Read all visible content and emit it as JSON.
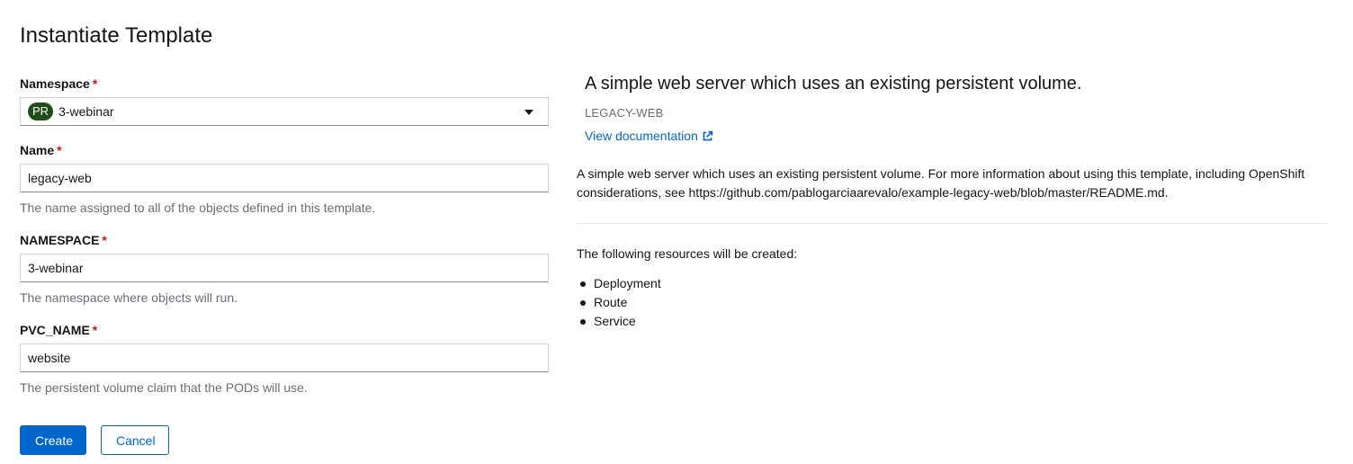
{
  "page": {
    "title": "Instantiate Template"
  },
  "form": {
    "namespace": {
      "label": "Namespace",
      "required_mark": "*",
      "badge": "PR",
      "value": "3-webinar"
    },
    "name": {
      "label": "Name",
      "required_mark": "*",
      "value": "legacy-web",
      "helper": "The name assigned to all of the objects defined in this template."
    },
    "namespace_param": {
      "label": "NAMESPACE",
      "required_mark": "*",
      "value": "3-webinar",
      "helper": "The namespace where objects will run."
    },
    "pvc_name": {
      "label": "PVC_NAME",
      "required_mark": "*",
      "value": "website",
      "helper": "The persistent volume claim that the PODs will use."
    }
  },
  "actions": {
    "create_label": "Create",
    "cancel_label": "Cancel"
  },
  "template_info": {
    "title": "A simple web server which uses an existing persistent volume.",
    "subtitle": "LEGACY-WEB",
    "doc_link_label": "View documentation",
    "description": "A simple web server which uses an existing persistent volume. For more information about using this template, including OpenShift considerations, see https://github.com/pablogarciaarevalo/example-legacy-web/blob/master/README.md.",
    "resources_heading": "The following resources will be created:",
    "resources": [
      "Deployment",
      "Route",
      "Service"
    ]
  },
  "colors": {
    "primary": "#0066cc",
    "required": "#c9190b",
    "badge_bg": "#1e4f18",
    "helper_text": "#6a6e73"
  },
  "icons": {
    "namespace_select": "chevron-down-icon",
    "doc_link": "external-link-icon",
    "resource_bullet": "bullet-icon"
  }
}
